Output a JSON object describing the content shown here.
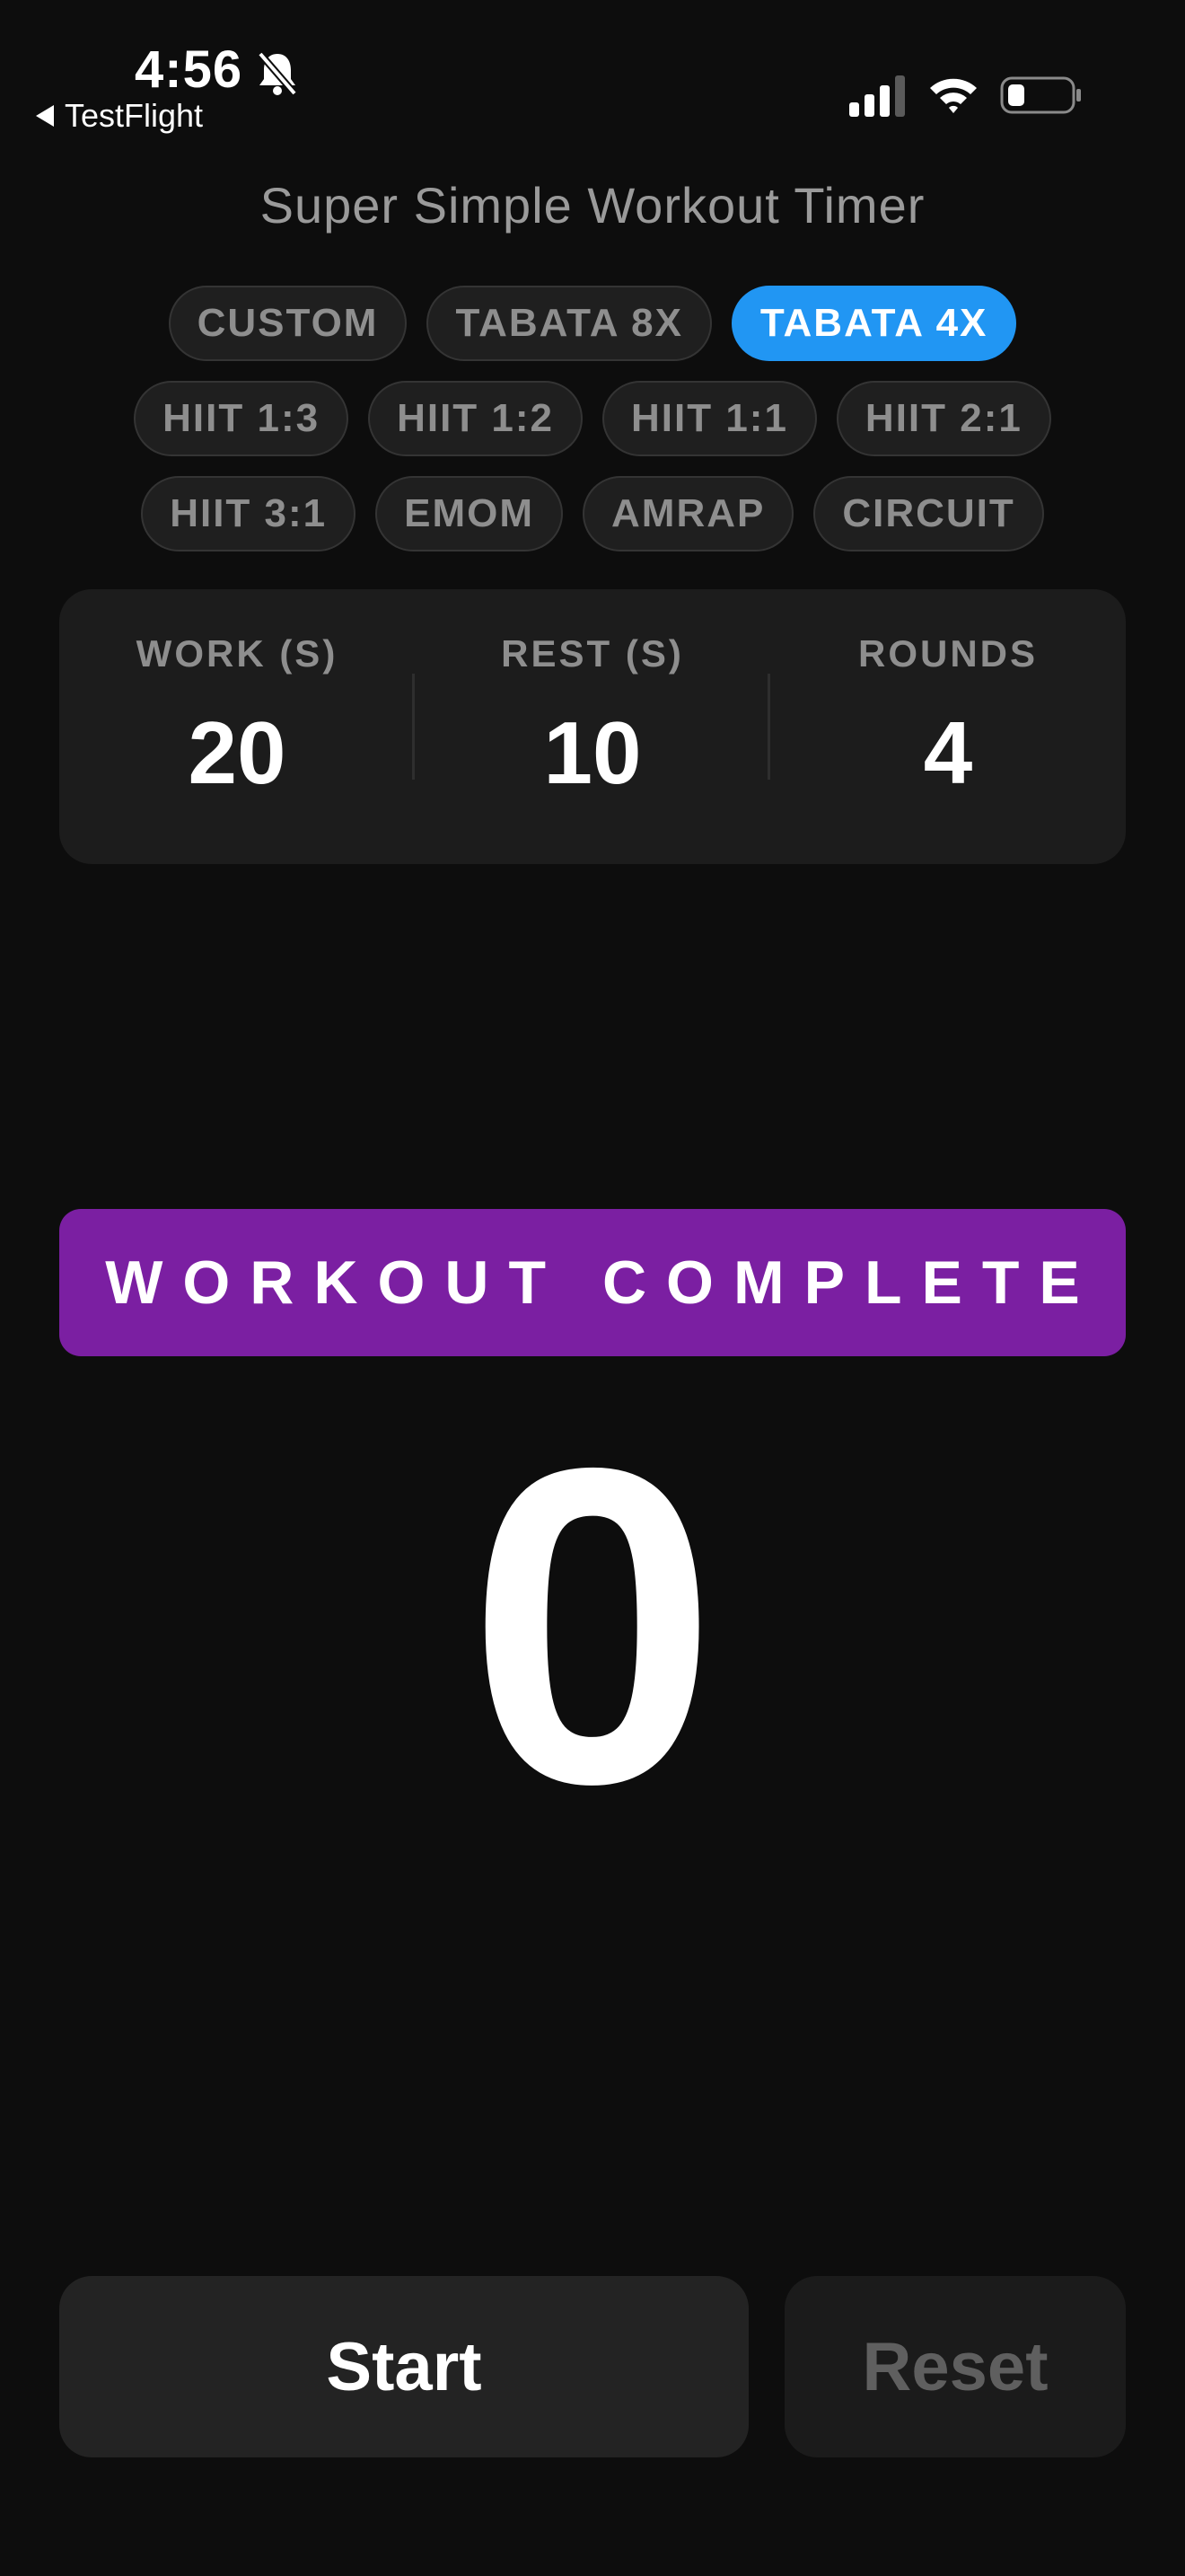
{
  "status_bar": {
    "time": "4:56",
    "back_label": "TestFlight",
    "icons": [
      "bell-slash-icon",
      "cellular-signal-icon",
      "wifi-icon",
      "battery-icon"
    ]
  },
  "app": {
    "title": "Super Simple Workout Timer"
  },
  "presets": {
    "row1": [
      "CUSTOM",
      "TABATA 8X",
      "TABATA 4X"
    ],
    "row2": [
      "HIIT 1:3",
      "HIIT 1:2",
      "HIIT 1:1",
      "HIIT 2:1"
    ],
    "row3": [
      "HIIT 3:1",
      "EMOM",
      "AMRAP",
      "CIRCUIT"
    ],
    "selected": "TABATA 4X"
  },
  "settings": {
    "work": {
      "label": "WORK (S)",
      "value": "20"
    },
    "rest": {
      "label": "REST (S)",
      "value": "10"
    },
    "rounds": {
      "label": "ROUNDS",
      "value": "4"
    }
  },
  "status": {
    "banner": "WORKOUT COMPLETE"
  },
  "timer": {
    "value": "0"
  },
  "controls": {
    "start_label": "Start",
    "reset_label": "Reset"
  },
  "colors": {
    "background": "#0d0d0d",
    "accent_blue": "#2196f3",
    "banner_purple": "#7b1fa2",
    "card": "#1c1c1c",
    "muted_text": "#8e8e8e"
  }
}
